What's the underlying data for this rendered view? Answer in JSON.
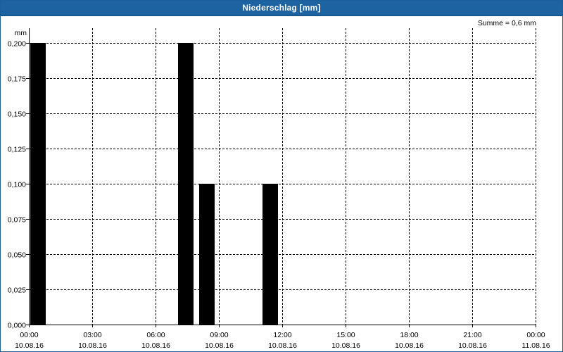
{
  "window": {
    "title": "Niederschlag [mm]"
  },
  "chart_data": {
    "type": "bar",
    "title": "Niederschlag [mm]",
    "ylabel": "mm",
    "annotation": "Summe = 0,6 mm",
    "ylim": [
      0,
      0.2
    ],
    "xlim_hours": [
      0,
      24
    ],
    "y_ticks": [
      {
        "value": 0.2,
        "label": "0,200"
      },
      {
        "value": 0.175,
        "label": "0,175"
      },
      {
        "value": 0.15,
        "label": "0,150"
      },
      {
        "value": 0.125,
        "label": "0,125"
      },
      {
        "value": 0.1,
        "label": "0,100"
      },
      {
        "value": 0.075,
        "label": "0,075"
      },
      {
        "value": 0.05,
        "label": "0,050"
      },
      {
        "value": 0.025,
        "label": "0,025"
      },
      {
        "value": 0.0,
        "label": "0,000"
      }
    ],
    "x_ticks": [
      {
        "hour": 0,
        "time": "00:00",
        "date": "10.08.16"
      },
      {
        "hour": 3,
        "time": "03:00",
        "date": "10.08.16"
      },
      {
        "hour": 6,
        "time": "06:00",
        "date": "10.08.16"
      },
      {
        "hour": 9,
        "time": "09:00",
        "date": "10.08.16"
      },
      {
        "hour": 12,
        "time": "12:00",
        "date": "10.08.16"
      },
      {
        "hour": 15,
        "time": "15:00",
        "date": "10.08.16"
      },
      {
        "hour": 18,
        "time": "18:00",
        "date": "10.08.16"
      },
      {
        "hour": 21,
        "time": "21:00",
        "date": "10.08.16"
      },
      {
        "hour": 24,
        "time": "00:00",
        "date": "11.08.16"
      }
    ],
    "bars": [
      {
        "start_hour": 0,
        "end_hour": 1,
        "value": 0.2
      },
      {
        "start_hour": 7,
        "end_hour": 8,
        "value": 0.2
      },
      {
        "start_hour": 8,
        "end_hour": 9,
        "value": 0.1
      },
      {
        "start_hour": 11,
        "end_hour": 12,
        "value": 0.1
      }
    ],
    "grid": true,
    "colors": {
      "bar": "#000000",
      "titlebar": "#1e63a1",
      "grid": "#000000"
    }
  }
}
